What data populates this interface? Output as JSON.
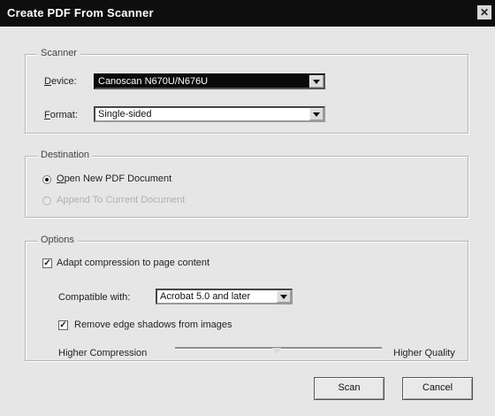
{
  "window": {
    "title": "Create PDF From Scanner",
    "close_glyph": "✕"
  },
  "scanner": {
    "legend": "Scanner",
    "device_label": "Device:",
    "device_value": "Canoscan N670U/N676U",
    "format_label": "Format:",
    "format_value": "Single-sided"
  },
  "destination": {
    "legend": "Destination",
    "open_new": "Open New PDF Document",
    "append": "Append To Current Document",
    "selected": "open_new"
  },
  "options": {
    "legend": "Options",
    "adapt_label": "Adapt compression to page content",
    "adapt_checked": true,
    "compat_label": "Compatible with:",
    "compat_value": "Acrobat 5.0 and later",
    "remove_label": "Remove edge shadows from images",
    "remove_checked": true,
    "slider_left": "Higher Compression",
    "slider_right": "Higher Quality",
    "slider_value": 0.5
  },
  "buttons": {
    "scan": "Scan",
    "cancel": "Cancel"
  }
}
